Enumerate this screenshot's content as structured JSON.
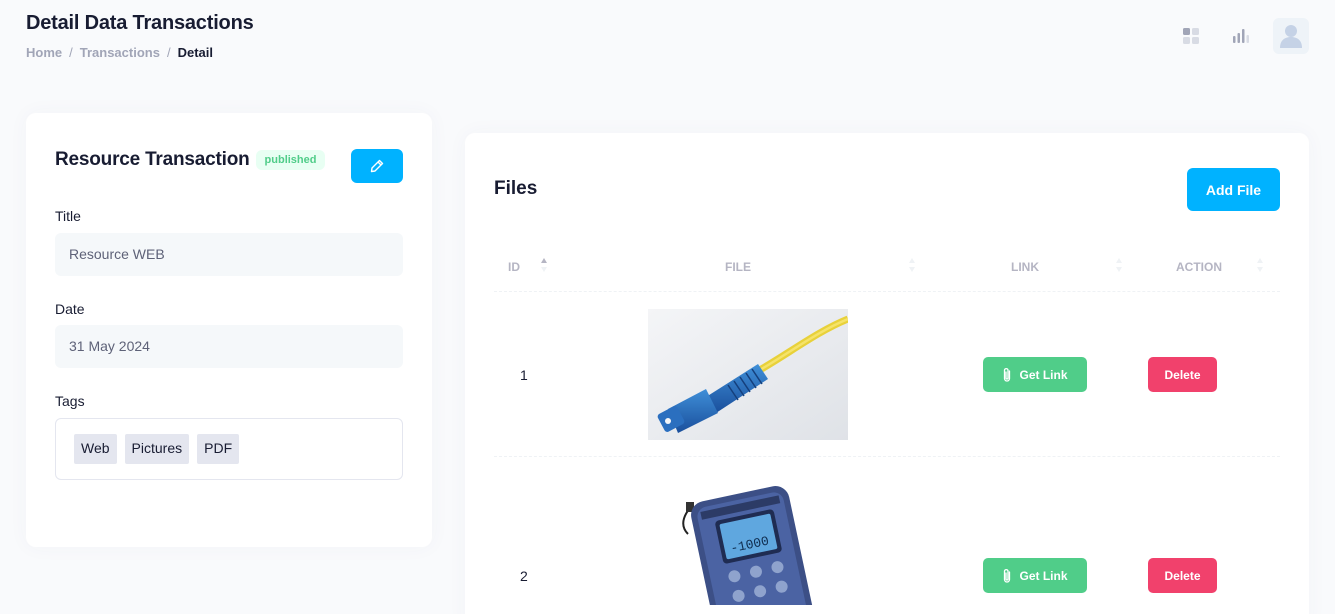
{
  "header": {
    "title": "Detail Data Transactions",
    "breadcrumb": {
      "home": "Home",
      "sep": "/",
      "transactions": "Transactions",
      "current": "Detail"
    },
    "icons": [
      "grid-icon",
      "chart-icon",
      "user-avatar-icon"
    ]
  },
  "resource": {
    "title": "Resource Transaction",
    "status": "published",
    "fields": {
      "title_label": "Title",
      "title_value": "Resource WEB",
      "date_label": "Date",
      "date_value": "31 May 2024",
      "tags_label": "Tags"
    },
    "tags": [
      "Web",
      "Pictures",
      "PDF"
    ]
  },
  "files": {
    "title": "Files",
    "add_label": "Add File",
    "columns": [
      "ID",
      "FILE",
      "LINK",
      "ACTION"
    ],
    "rows": [
      {
        "id": "1",
        "file": "fiber-optic-connector-image",
        "link_label": "Get Link",
        "action_label": "Delete"
      },
      {
        "id": "2",
        "file": "optical-power-meter-image",
        "link_label": "Get Link",
        "action_label": "Delete"
      }
    ]
  },
  "colors": {
    "primary": "#00b2ff",
    "success": "#50cd89",
    "danger": "#f1416c",
    "badge_bg": "#e8fff3"
  }
}
